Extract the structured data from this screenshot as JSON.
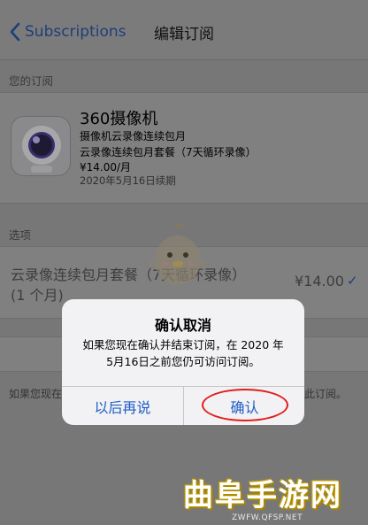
{
  "nav": {
    "back_label": "Subscriptions",
    "title": "编辑订阅"
  },
  "subscription": {
    "section_label": "您的订阅",
    "app_name": "360摄像机",
    "plan_line": "摄像机云录像连续包月",
    "plan_detail": "云录像连续包月套餐（7天循环录像）",
    "price": "¥14.00/月",
    "renewal": "2020年5月16日续期"
  },
  "options": {
    "section_label": "选项",
    "item_line1": "云录像连续包月套餐（7天循环录像）",
    "item_line2": "(1 个月)",
    "item_price": "¥14.00",
    "check": "✓"
  },
  "footnote": {
    "left": "如果您现在",
    "right": "此订阅。"
  },
  "alert": {
    "title": "确认取消",
    "message_line1": "如果您现在确认并结束订阅，在 2020 年",
    "message_line2": "5月16日之前您仍可访问订阅。",
    "cancel_label": "以后再说",
    "confirm_label": "确认"
  },
  "watermark": {
    "title": "曲阜手游网",
    "url": "ZWFW.QFSP.NET"
  },
  "colors": {
    "accent": "#1f5dc7",
    "highlight_circle": "#e11d1d"
  }
}
